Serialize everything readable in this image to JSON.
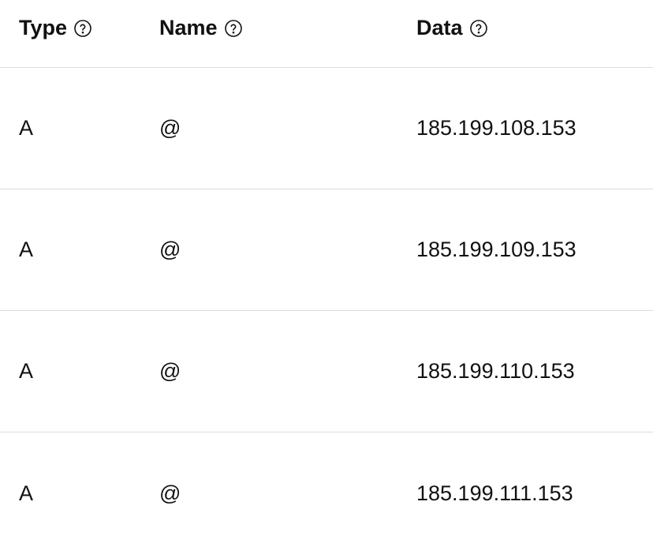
{
  "columns": {
    "type": "Type",
    "name": "Name",
    "data": "Data"
  },
  "rows": [
    {
      "type": "A",
      "name": "@",
      "data": "185.199.108.153"
    },
    {
      "type": "A",
      "name": "@",
      "data": "185.199.109.153"
    },
    {
      "type": "A",
      "name": "@",
      "data": "185.199.110.153"
    },
    {
      "type": "A",
      "name": "@",
      "data": "185.199.111.153"
    }
  ]
}
